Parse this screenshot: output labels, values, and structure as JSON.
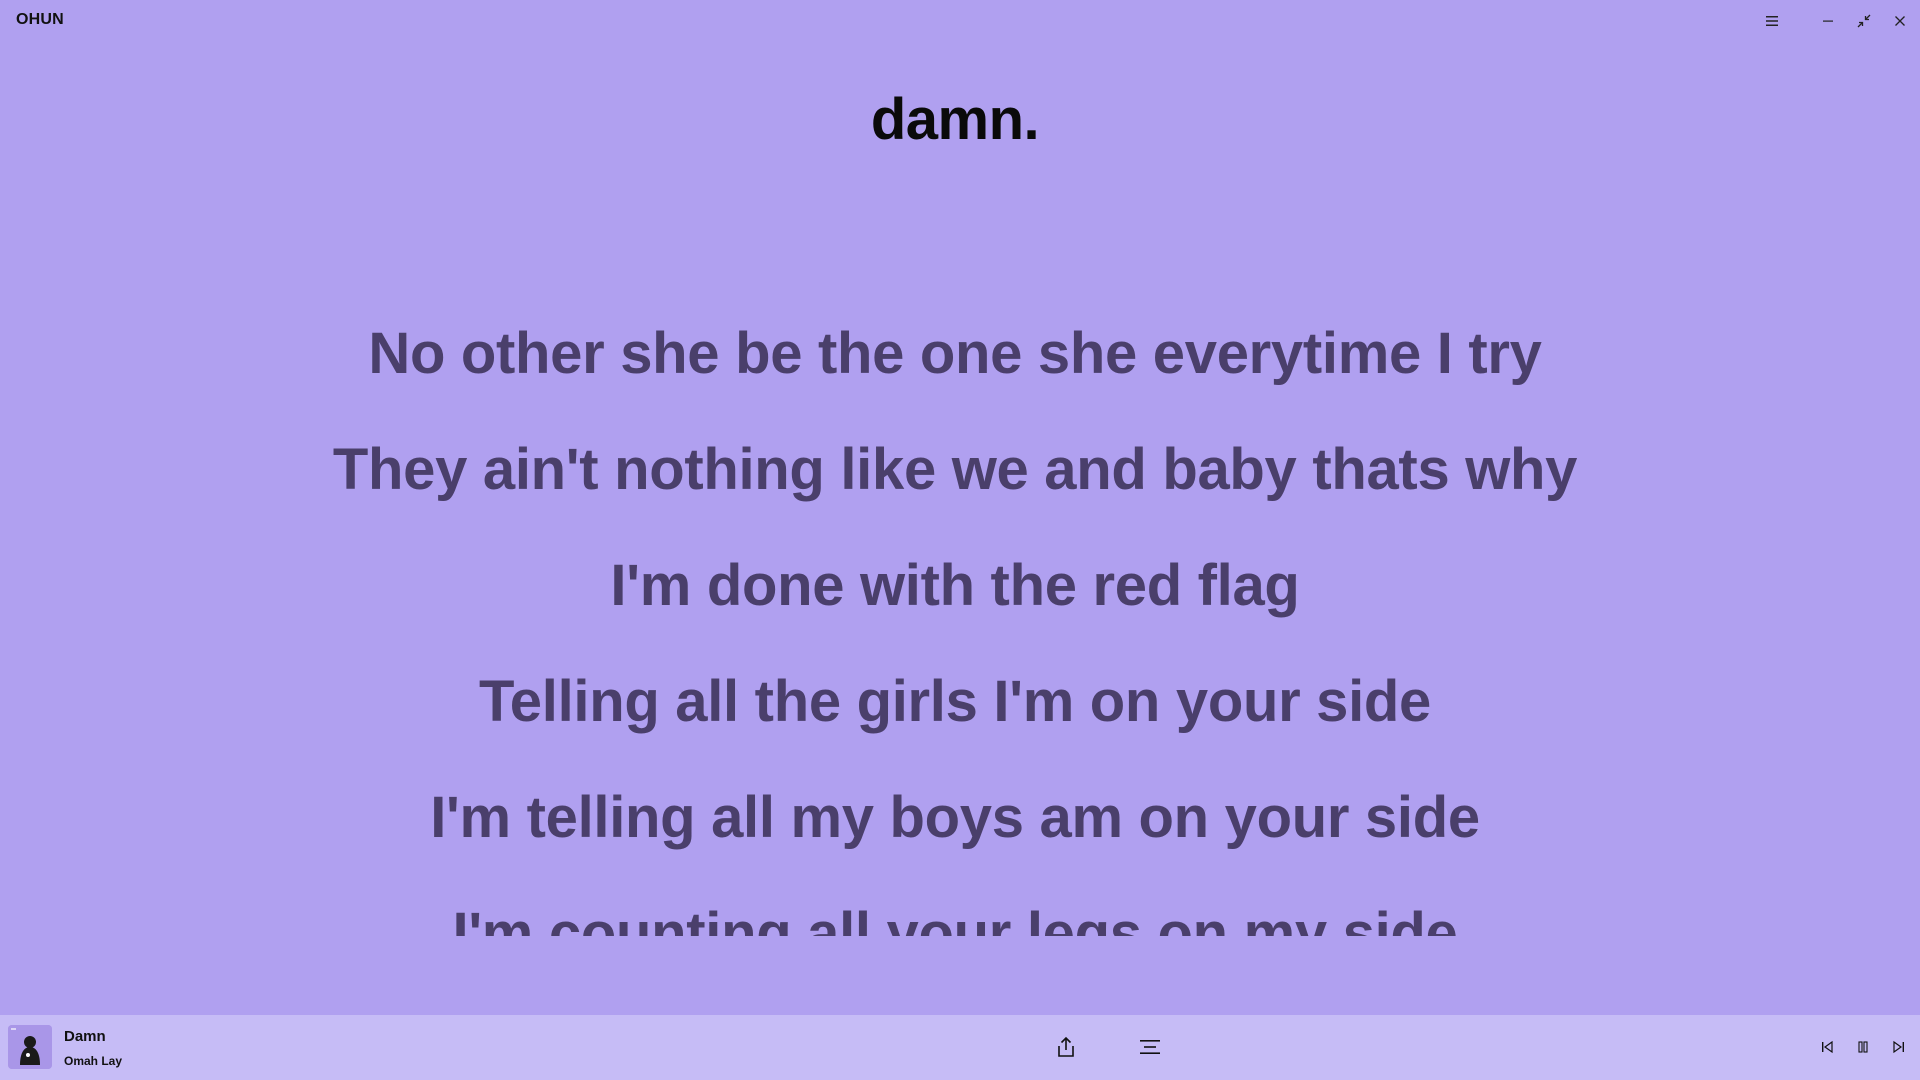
{
  "window": {
    "app_name": "OHUN",
    "controls": [
      "menu-icon",
      "minimize-icon",
      "collapse-icon",
      "close-icon"
    ]
  },
  "lyrics": {
    "song_heading": "damn.",
    "lines": [
      "No other she be the one she everytime I try",
      "They ain't nothing like we and baby thats why",
      "I'm done with the red flag",
      "Telling all the girls I'm on your side",
      "I'm telling all my boys am on your side",
      "I'm counting all your legs on my side"
    ]
  },
  "player": {
    "track_title": "Damn",
    "artist": "Omah Lay",
    "center_controls": [
      "share-icon",
      "lyrics-view-icon"
    ],
    "playback_controls": [
      "previous-icon",
      "pause-icon",
      "next-icon"
    ]
  },
  "colors": {
    "background": "#b0a0f0",
    "player_bar": "#c6bcf6",
    "lyric_text": "#4a3f6b",
    "heading_text": "#0a0a0a"
  }
}
